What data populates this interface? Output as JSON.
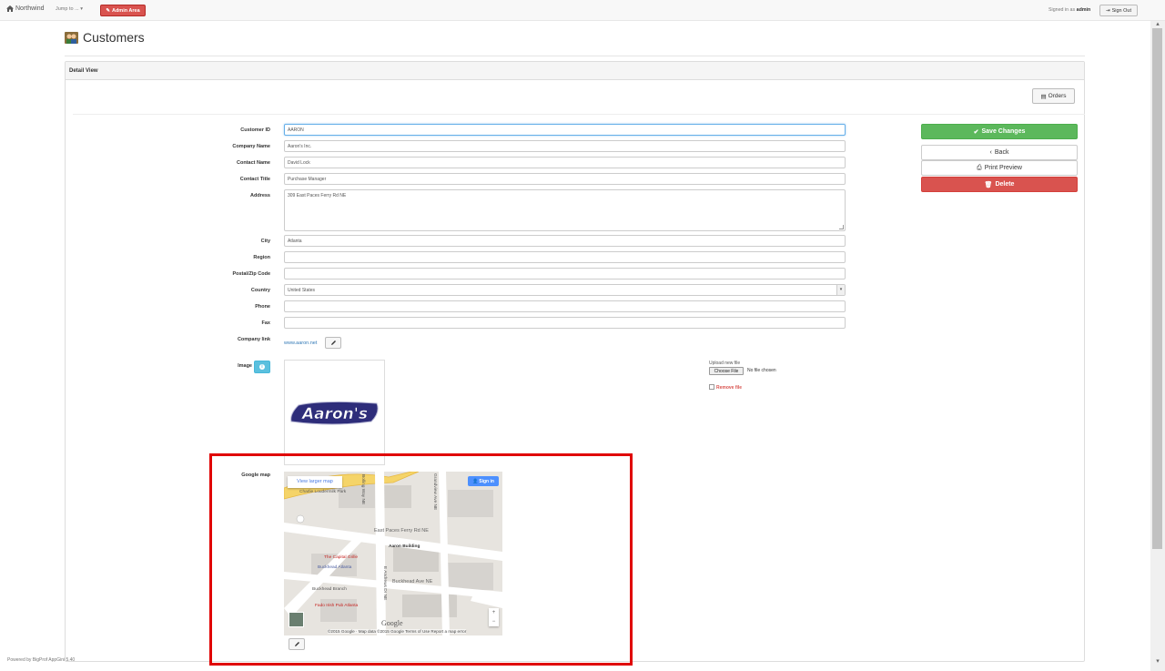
{
  "nav": {
    "brand": "Northwind",
    "jump": "Jump to ...",
    "admin": "Admin Area",
    "signed_prefix": "Signed in as",
    "user": "admin",
    "signout": "Sign Out"
  },
  "page": {
    "title": "Customers",
    "panel": "Detail View"
  },
  "orders_button": "Orders",
  "form": {
    "customer_id": {
      "label": "Customer ID",
      "value": "AARON"
    },
    "company_name": {
      "label": "Company Name",
      "value": "Aaron's Inc."
    },
    "contact_name": {
      "label": "Contact Name",
      "value": "David Lock"
    },
    "contact_title": {
      "label": "Contact Title",
      "value": "Purchase Manager"
    },
    "address": {
      "label": "Address",
      "value": "309 East Paces Ferry Rd NE"
    },
    "city": {
      "label": "City",
      "value": "Atlanta"
    },
    "region": {
      "label": "Region",
      "value": ""
    },
    "postal": {
      "label": "Postal/Zip Code",
      "value": ""
    },
    "country": {
      "label": "Country",
      "value": "United States"
    },
    "phone": {
      "label": "Phone",
      "value": ""
    },
    "fax": {
      "label": "Fax",
      "value": ""
    },
    "company_link": {
      "label": "Company link",
      "value": "www.aaron.net"
    },
    "image": {
      "label": "Image",
      "logo_text": "Aaron's"
    },
    "upload": {
      "label": "Upload new file",
      "choose": "Choose File",
      "nofile": "No file chosen",
      "remove": "Remove file"
    },
    "google_map": {
      "label": "Google map"
    }
  },
  "actions": {
    "save": "Save Changes",
    "back": "Back",
    "print": "Print Preview",
    "delete": "Delete"
  },
  "map": {
    "larger": "View larger map",
    "signin": "Sign in",
    "labels": {
      "park": "Charlie Loudermilk Park",
      "peachtree": "Peachtree Rd NE",
      "paces": "East Paces Ferry Rd NE",
      "aaron": "Aaron Building",
      "capital": "The Capital Grille",
      "buckhead_atl": "Buckhead Atlanta",
      "buckhead_ave": "Buckhead Ave NE",
      "branch": "Buckhead Branch",
      "fado": "Fado Irish Pub Atlanta",
      "grandview": "Grandview Ave NE",
      "bolling": "Bolling Way NE",
      "e_andrews": "E Andrews Dr NE"
    },
    "google": "Google",
    "attribution": "©2015 Google · Map data ©2015 Google   Terms of Use   Report a map error"
  },
  "footer": "Powered by BigProf AppGini 5.40",
  "colors": {
    "save": "#5cb85c",
    "delete": "#d9534f",
    "info": "#5bc0de",
    "highlight": "#e00000"
  }
}
